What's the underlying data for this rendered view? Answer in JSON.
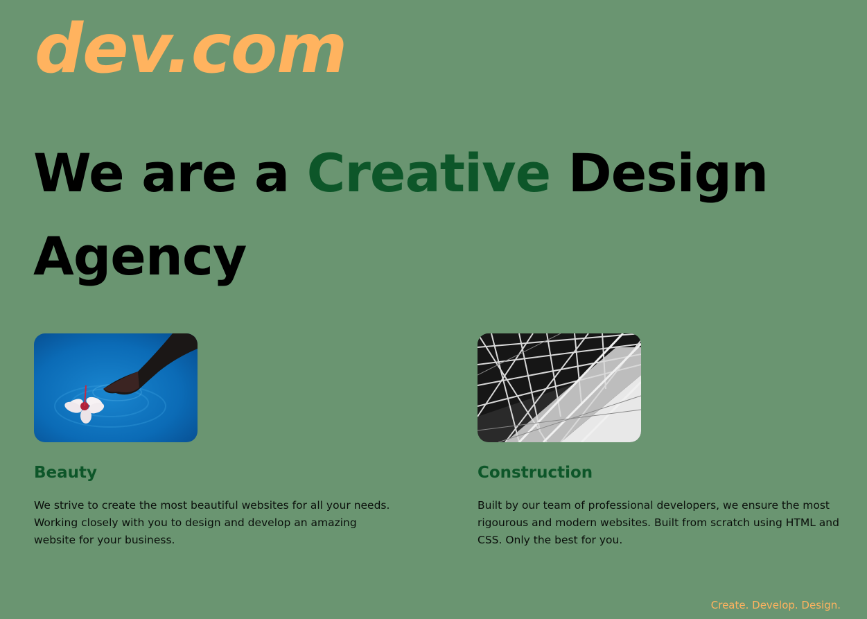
{
  "colors": {
    "background": "#6a9571",
    "accent_orange": "#ffb35f",
    "accent_green": "#0d5629",
    "text_dark": "#000000"
  },
  "logo": {
    "text": "dev.com"
  },
  "hero": {
    "prefix": "We are a ",
    "highlight": "Creative",
    "suffix": " Design Agency"
  },
  "cards": [
    {
      "image_description": "hand-with-flower-in-water-photo",
      "title": "Beauty",
      "text": "We strive to create the most beautiful websites for all your needs. Working closely with you to design and develop an amazing website for your business."
    },
    {
      "image_description": "steel-structure-photo",
      "title": "Construction",
      "text": "Built by our team of professional developers, we ensure the most rigourous and modern websites. Built from scratch using HTML and CSS. Only the best for you."
    }
  ],
  "footer": {
    "tagline": "Create. Develop. Design."
  }
}
